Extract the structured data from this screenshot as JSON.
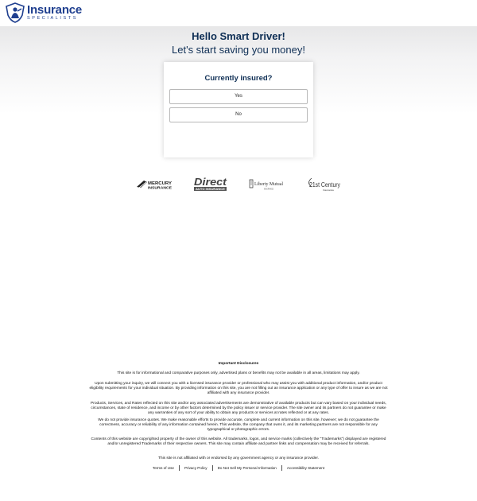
{
  "header": {
    "logo_main": "Insurance",
    "logo_sub": "SPECIALISTS"
  },
  "hero": {
    "title": "Hello Smart Driver!",
    "subtitle": "Let's start saving you money!"
  },
  "question_card": {
    "question": "Currently insured?",
    "options": [
      "Yes",
      "No"
    ]
  },
  "partners": {
    "mercury": "MERCURY INSURANCE",
    "direct": "Direct",
    "direct_sub": "AUTO INSURANCE",
    "liberty": "Liberty Mutual",
    "liberty_sub": "INSURANCE",
    "century": "21st Century",
    "century_sub": "Insurance"
  },
  "disclosures": {
    "title": "Important Disclosures",
    "paragraphs": [
      "This site is for informational and comparative purposes only, advertised plans or benefits may not be available in all areas, limitations may apply.",
      "Upon submitting your inquiry, we will connect you with a licensed insurance provider or professional who may assist you with additional product information, and/or product eligibility requirements for your individual situation. By providing information on this site, you are not filling out an insurance application or any type of offer to insure as we are not affiliated with any insurance provider.",
      "Products, Services, and Rates reflected on this site and/or any associated advertisements are demonstrative of available products but can vary based on your individual needs, circumstances, state of residence, and income or by other factors determined by the policy issuer or service provider. The site owner and its partners do not guarantee or make any warranties of any sort of your ability to obtain any products or services at rates reflected or at any rates.",
      "We do not provide insurance quotes. We make reasonable efforts to provide accurate, complete and current information on this site, however; we do not guarantee the correctness, accuracy or reliability of any information contained herein. This website, the company that owns it, and its marketing partners are not responsible for any typographical or photographic errors.",
      "Contents of this website are copyrighted property of the owner of this website. All trademarks, logos, and service marks (collectively the \"Trademarks\") displayed are registered and/or unregistered Trademarks of their respective owners. This site may contain affiliate and partner links and compensation may be received for referrals.",
      "This site is not affiliated with or endorsed by any government agency or any insurance provider."
    ]
  },
  "footer": {
    "links": [
      "Terms of Use",
      "Privacy Policy",
      "Do Not Sell My Personal Information",
      "Accessibility Statement"
    ]
  },
  "colors": {
    "brand": "#1f3f8f",
    "heading": "#0f2f55"
  }
}
